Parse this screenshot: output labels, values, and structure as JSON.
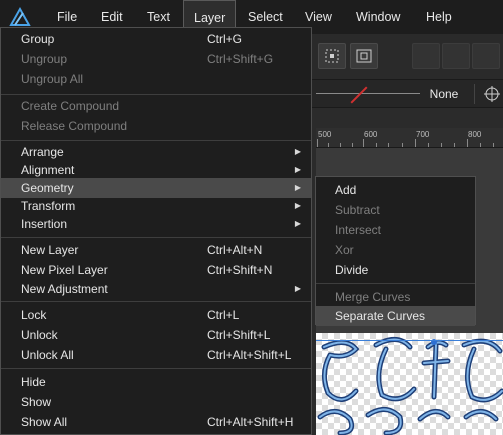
{
  "menubar": {
    "logo_icon": "affinity-designer-logo-icon",
    "items": [
      {
        "label": "File"
      },
      {
        "label": "Edit"
      },
      {
        "label": "Text"
      },
      {
        "label": "Layer"
      },
      {
        "label": "Select"
      },
      {
        "label": "View"
      },
      {
        "label": "Window"
      },
      {
        "label": "Help"
      }
    ],
    "active_menu": "Layer"
  },
  "context_toolbar": {
    "stroke_value": "None"
  },
  "ruler": {
    "labels": [
      "500",
      "600",
      "700",
      "800"
    ]
  },
  "layer_menu": {
    "items": [
      {
        "label": "Group",
        "shortcut": "Ctrl+G",
        "enabled": true,
        "submenu": false
      },
      {
        "label": "Ungroup",
        "shortcut": "Ctrl+Shift+G",
        "enabled": false,
        "submenu": false
      },
      {
        "label": "Ungroup All",
        "shortcut": "",
        "enabled": false,
        "submenu": false
      },
      {
        "label": "Create Compound",
        "shortcut": "",
        "enabled": false,
        "submenu": false
      },
      {
        "label": "Release Compound",
        "shortcut": "",
        "enabled": false,
        "submenu": false
      },
      {
        "label": "Arrange",
        "shortcut": "",
        "enabled": true,
        "submenu": true
      },
      {
        "label": "Alignment",
        "shortcut": "",
        "enabled": true,
        "submenu": true
      },
      {
        "label": "Geometry",
        "shortcut": "",
        "enabled": true,
        "submenu": true,
        "highlighted": true
      },
      {
        "label": "Transform",
        "shortcut": "",
        "enabled": true,
        "submenu": true
      },
      {
        "label": "Insertion",
        "shortcut": "",
        "enabled": true,
        "submenu": true
      },
      {
        "label": "New Layer",
        "shortcut": "Ctrl+Alt+N",
        "enabled": true,
        "submenu": false
      },
      {
        "label": "New Pixel Layer",
        "shortcut": "Ctrl+Shift+N",
        "enabled": true,
        "submenu": false
      },
      {
        "label": "New Adjustment",
        "shortcut": "",
        "enabled": true,
        "submenu": true
      },
      {
        "label": "Lock",
        "shortcut": "Ctrl+L",
        "enabled": true,
        "submenu": false
      },
      {
        "label": "Unlock",
        "shortcut": "Ctrl+Shift+L",
        "enabled": true,
        "submenu": false
      },
      {
        "label": "Unlock All",
        "shortcut": "Ctrl+Alt+Shift+L",
        "enabled": true,
        "submenu": false
      },
      {
        "label": "Hide",
        "shortcut": "",
        "enabled": true,
        "submenu": false
      },
      {
        "label": "Show",
        "shortcut": "",
        "enabled": true,
        "submenu": false
      },
      {
        "label": "Show All",
        "shortcut": "Ctrl+Alt+Shift+H",
        "enabled": true,
        "submenu": false
      }
    ]
  },
  "geometry_submenu": {
    "items": [
      {
        "label": "Add",
        "enabled": true
      },
      {
        "label": "Subtract",
        "enabled": false
      },
      {
        "label": "Intersect",
        "enabled": false
      },
      {
        "label": "Xor",
        "enabled": false
      },
      {
        "label": "Divide",
        "enabled": true
      },
      {
        "label": "Merge Curves",
        "enabled": false
      },
      {
        "label": "Separate Curves",
        "enabled": true,
        "highlighted": true
      }
    ]
  },
  "colors": {
    "menu_bg": "#1e1e1e",
    "highlight": "#4a4a4a",
    "disabled_text": "#7f7f7f",
    "logo_blue": "#4aa3e8",
    "selection_blue": "#3b7fd8"
  }
}
